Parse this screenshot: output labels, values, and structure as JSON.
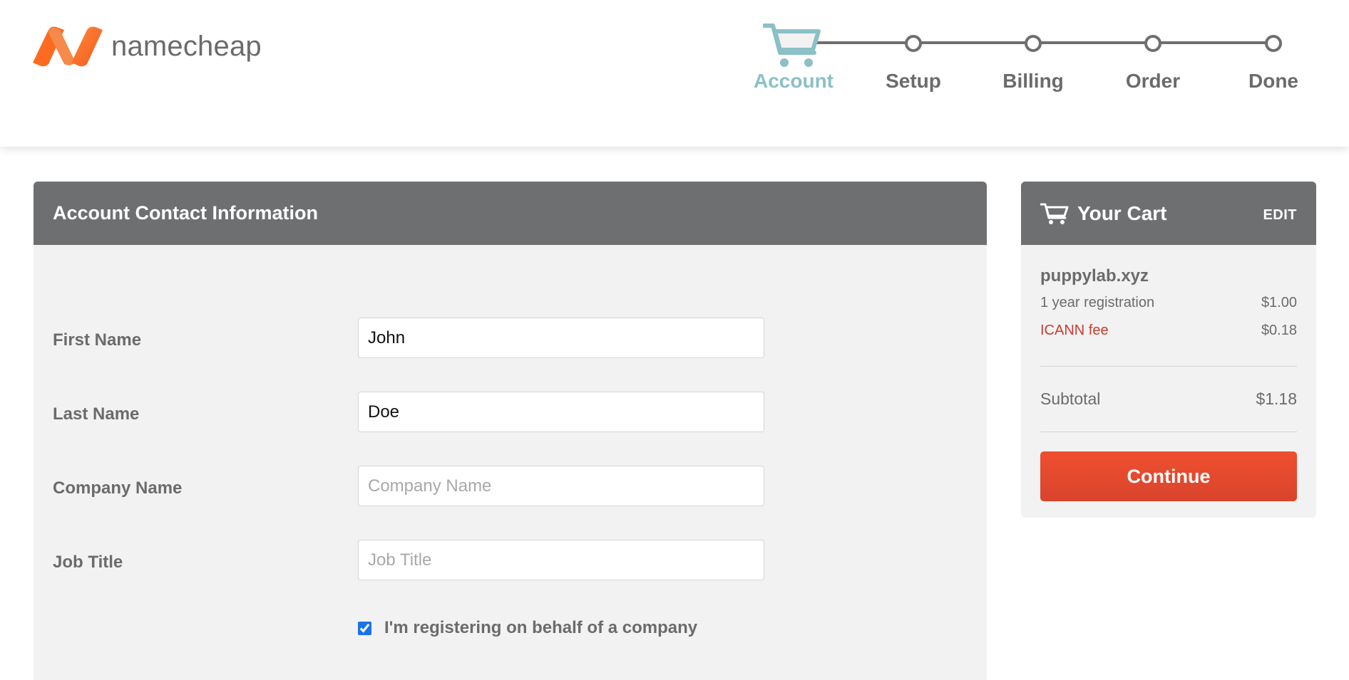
{
  "brand": {
    "name": "namecheap",
    "accent": "#fe6a1f"
  },
  "stepper": {
    "steps": [
      {
        "label": "Account",
        "active": true
      },
      {
        "label": "Setup",
        "active": false
      },
      {
        "label": "Billing",
        "active": false
      },
      {
        "label": "Order",
        "active": false
      },
      {
        "label": "Done",
        "active": false
      }
    ]
  },
  "form": {
    "title": "Account Contact Information",
    "fields": [
      {
        "label": "First Name",
        "value": "John",
        "placeholder": ""
      },
      {
        "label": "Last Name",
        "value": "Doe",
        "placeholder": ""
      },
      {
        "label": "Company Name",
        "value": "",
        "placeholder": "Company Name"
      },
      {
        "label": "Job Title",
        "value": "",
        "placeholder": "Job Title"
      }
    ],
    "company_checkbox": {
      "label": "I'm registering on behalf of a company",
      "checked": true
    }
  },
  "cart": {
    "title": "Your Cart",
    "edit_label": "EDIT",
    "domain": "puppylab.xyz",
    "items": [
      {
        "label": "1 year registration",
        "amount": "$1.00"
      },
      {
        "label": "ICANN fee",
        "amount": "$0.18"
      }
    ],
    "subtotal_label": "Subtotal",
    "subtotal_amount": "$1.18",
    "continue_label": "Continue",
    "continue_color": "#e84a2f"
  }
}
